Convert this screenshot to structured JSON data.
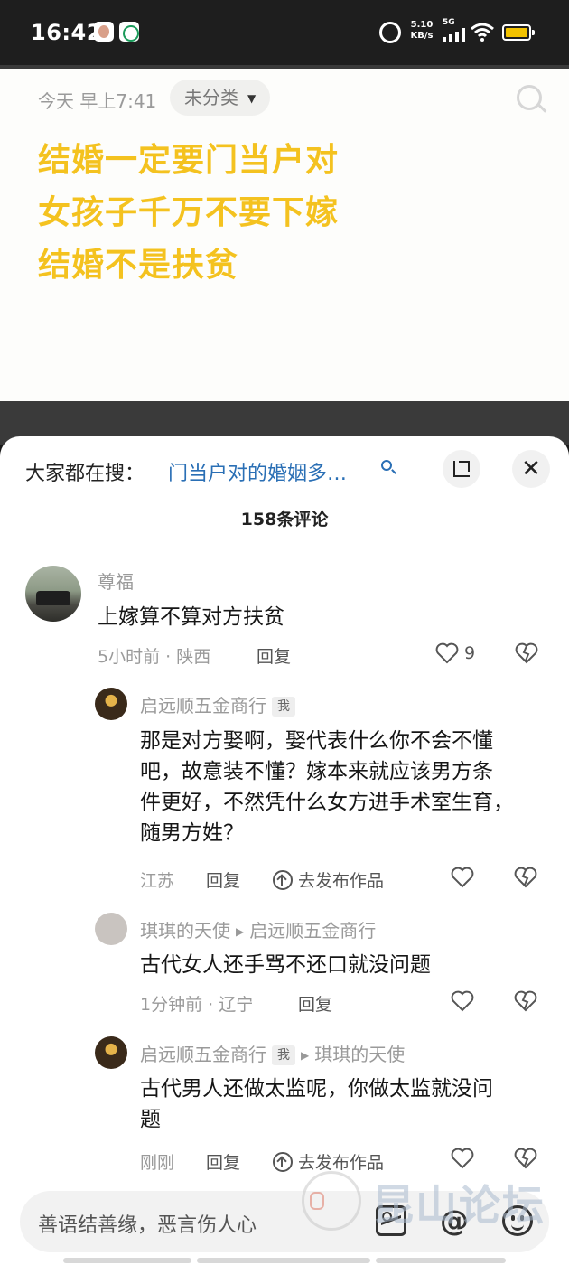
{
  "status_bar": {
    "time": "16:42",
    "net_speed_value": "5.10",
    "net_speed_unit": "KB/s",
    "network": "5G",
    "icons": [
      "app-avatar-icon",
      "app-green-icon",
      "alarm-icon",
      "signal-icon",
      "wifi-icon",
      "battery-icon"
    ]
  },
  "note": {
    "date": "今天 早上7:41",
    "category": "未分类",
    "lines": [
      "结婚一定要门当户对",
      "女孩子千万不要下嫁",
      "结婚不是扶贫"
    ],
    "text_color": "#f4c21f"
  },
  "sheet": {
    "hot_search_label": "大家都在搜：",
    "hot_search_link": "门当户对的婚姻多…",
    "comment_count": "158条评论"
  },
  "comments": [
    {
      "user": "尊福",
      "text": "上嫁算不算对方扶贫",
      "meta": "5小时前 · 陕西",
      "reply": "回复",
      "likes": "9",
      "replies": [
        {
          "user": "启远顺五金商行",
          "me_tag": "我",
          "text_lines": [
            "那是对方娶啊，娶代表什么你不会不懂",
            "吧，故意装不懂？嫁本来就应该男方条",
            "件更好，不然凭什么女方进手术室生育，",
            "随男方姓？"
          ],
          "meta": "江苏",
          "reply": "回复",
          "publish": "去发布作品"
        },
        {
          "user": "琪琪的天使",
          "reply_to": "启远顺五金商行",
          "text": "古代女人还手骂不还口就没问题",
          "meta": "1分钟前 · 辽宁",
          "reply": "回复"
        },
        {
          "user": "启远顺五金商行",
          "me_tag": "我",
          "reply_to": "琪琪的天使",
          "text_lines": [
            "古代男人还做太监呢，你做太监就没问",
            "题"
          ],
          "meta": "刚刚",
          "reply": "回复",
          "publish": "去发布作品"
        }
      ]
    }
  ],
  "input": {
    "placeholder": "善语结善缘，恶言伤人心"
  },
  "watermark": {
    "text": "昆山论坛"
  }
}
